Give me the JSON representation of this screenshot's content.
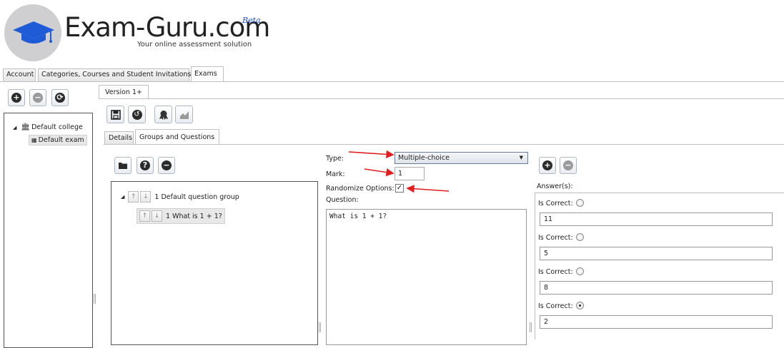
{
  "brand": {
    "name": "Exam-Guru.com",
    "beta": "Beta",
    "tagline": "Your online assessment solution"
  },
  "top_tabs": [
    {
      "label": "Account"
    },
    {
      "label": "Categories, Courses and Student Invitations"
    },
    {
      "label": "Exams",
      "active": true
    }
  ],
  "tree": {
    "college": "Default college",
    "exam": "Default exam"
  },
  "version_tab": "Version 1+",
  "inner_tabs": [
    {
      "label": "Details"
    },
    {
      "label": "Groups and Questions",
      "active": true
    }
  ],
  "question_tree": {
    "group": "1 Default question group",
    "question": "1 What is 1 + 1?"
  },
  "form": {
    "type_label": "Type:",
    "type_value": "Multiple-choice",
    "mark_label": "Mark:",
    "mark_value": "1",
    "randomize_label": "Randomize Options:",
    "randomize_checked": true,
    "question_label": "Question:",
    "question_value": "What is 1 + 1?"
  },
  "answers": {
    "label": "Answer(s):",
    "is_correct_label": "Is Correct:",
    "items": [
      {
        "value": "11",
        "correct": false
      },
      {
        "value": "5",
        "correct": false
      },
      {
        "value": "8",
        "correct": false
      },
      {
        "value": "2",
        "correct": true
      }
    ]
  },
  "colors": {
    "annotation_arrow": "#e11d1d",
    "brand_beta": "#1a4fd0",
    "logo_cap": "#1f5bd6"
  }
}
